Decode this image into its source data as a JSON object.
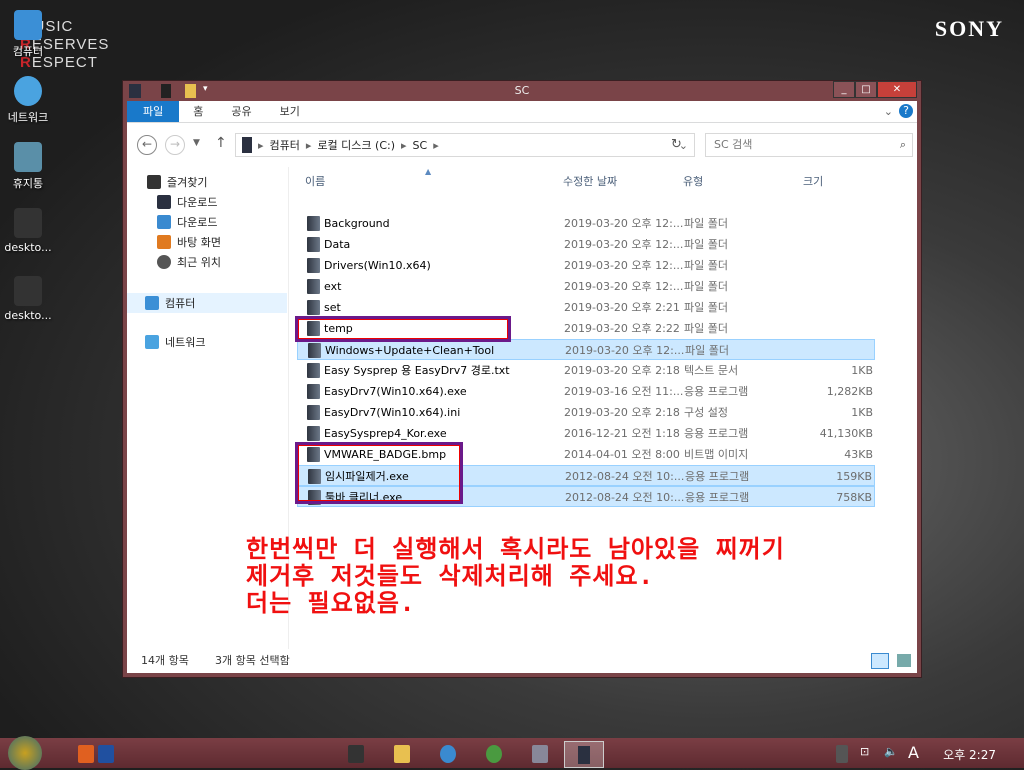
{
  "desktop": {
    "logo": [
      "USIC",
      "ESERVES",
      "ESPECT"
    ],
    "logo_letters": [
      "M",
      "R",
      "R"
    ],
    "brand": "SONY",
    "icons": [
      {
        "label": "컴퓨터"
      },
      {
        "label": "네트워크"
      },
      {
        "label": "휴지통"
      },
      {
        "label": "deskto..."
      },
      {
        "label": "deskto..."
      }
    ]
  },
  "window": {
    "title": "SC",
    "controls": [
      "_",
      "□",
      "✕"
    ],
    "ribbon_tabs": [
      "파일",
      "홈",
      "공유",
      "보기"
    ],
    "breadcrumb": [
      "컴퓨터",
      "로컬 디스크 (C:)",
      "SC"
    ],
    "search_placeholder": "SC 검색",
    "nav": {
      "favorites": "즐겨찾기",
      "items": [
        "다운로드",
        "다운로드",
        "바탕 화면",
        "최근 위치"
      ],
      "computer": "컴퓨터",
      "network": "네트워크"
    },
    "columns": [
      "이름",
      "수정한 날짜",
      "유형",
      "크기"
    ],
    "files": [
      {
        "name": "Background",
        "date": "2019-03-20 오후 12:...",
        "type": "파일 폴더",
        "size": ""
      },
      {
        "name": "Data",
        "date": "2019-03-20 오후 12:...",
        "type": "파일 폴더",
        "size": ""
      },
      {
        "name": "Drivers(Win10.x64)",
        "date": "2019-03-20 오후 12:...",
        "type": "파일 폴더",
        "size": ""
      },
      {
        "name": "ext",
        "date": "2019-03-20 오후 12:...",
        "type": "파일 폴더",
        "size": ""
      },
      {
        "name": "set",
        "date": "2019-03-20 오후 2:21",
        "type": "파일 폴더",
        "size": ""
      },
      {
        "name": "temp",
        "date": "2019-03-20 오후 2:22",
        "type": "파일 폴더",
        "size": ""
      },
      {
        "name": "Windows+Update+Clean+Tool",
        "date": "2019-03-20 오후 12:...",
        "type": "파일 폴더",
        "size": "",
        "selected": true
      },
      {
        "name": "Easy Sysprep 용 EasyDrv7 경로.txt",
        "date": "2019-03-20 오후 2:18",
        "type": "텍스트 문서",
        "size": "1KB"
      },
      {
        "name": "EasyDrv7(Win10.x64).exe",
        "date": "2019-03-16 오전 11:...",
        "type": "응용 프로그램",
        "size": "1,282KB"
      },
      {
        "name": "EasyDrv7(Win10.x64).ini",
        "date": "2019-03-20 오후 2:18",
        "type": "구성 설정",
        "size": "1KB"
      },
      {
        "name": "EasySysprep4_Kor.exe",
        "date": "2016-12-21 오전 1:18",
        "type": "응용 프로그램",
        "size": "41,130KB"
      },
      {
        "name": "VMWARE_BADGE.bmp",
        "date": "2014-04-01 오전 8:00",
        "type": "비트맵 이미지",
        "size": "43KB"
      },
      {
        "name": "임시파일제거.exe",
        "date": "2012-08-24 오전 10:...",
        "type": "응용 프로그램",
        "size": "159KB",
        "selected": true
      },
      {
        "name": "툴바 클리너.exe",
        "date": "2012-08-24 오전 10:...",
        "type": "응용 프로그램",
        "size": "758KB",
        "selected": true
      }
    ],
    "status": {
      "count": "14개 항목",
      "selected": "3개 항목 선택함"
    }
  },
  "annotation": [
    "한번씩만 더 실행해서 혹시라도 남아있을 찌꺼기",
    "제거후 저것들도 삭제처리해 주세요.",
    "더는 필요없음."
  ],
  "taskbar": {
    "clock": "오후 2:27",
    "ime": "A"
  },
  "colors": {
    "titlebar": "#7a4448",
    "accent": "#1979ca",
    "selection": "#cce8ff",
    "highlight_box": "#6b1a8a",
    "annotation": "#f01010"
  }
}
